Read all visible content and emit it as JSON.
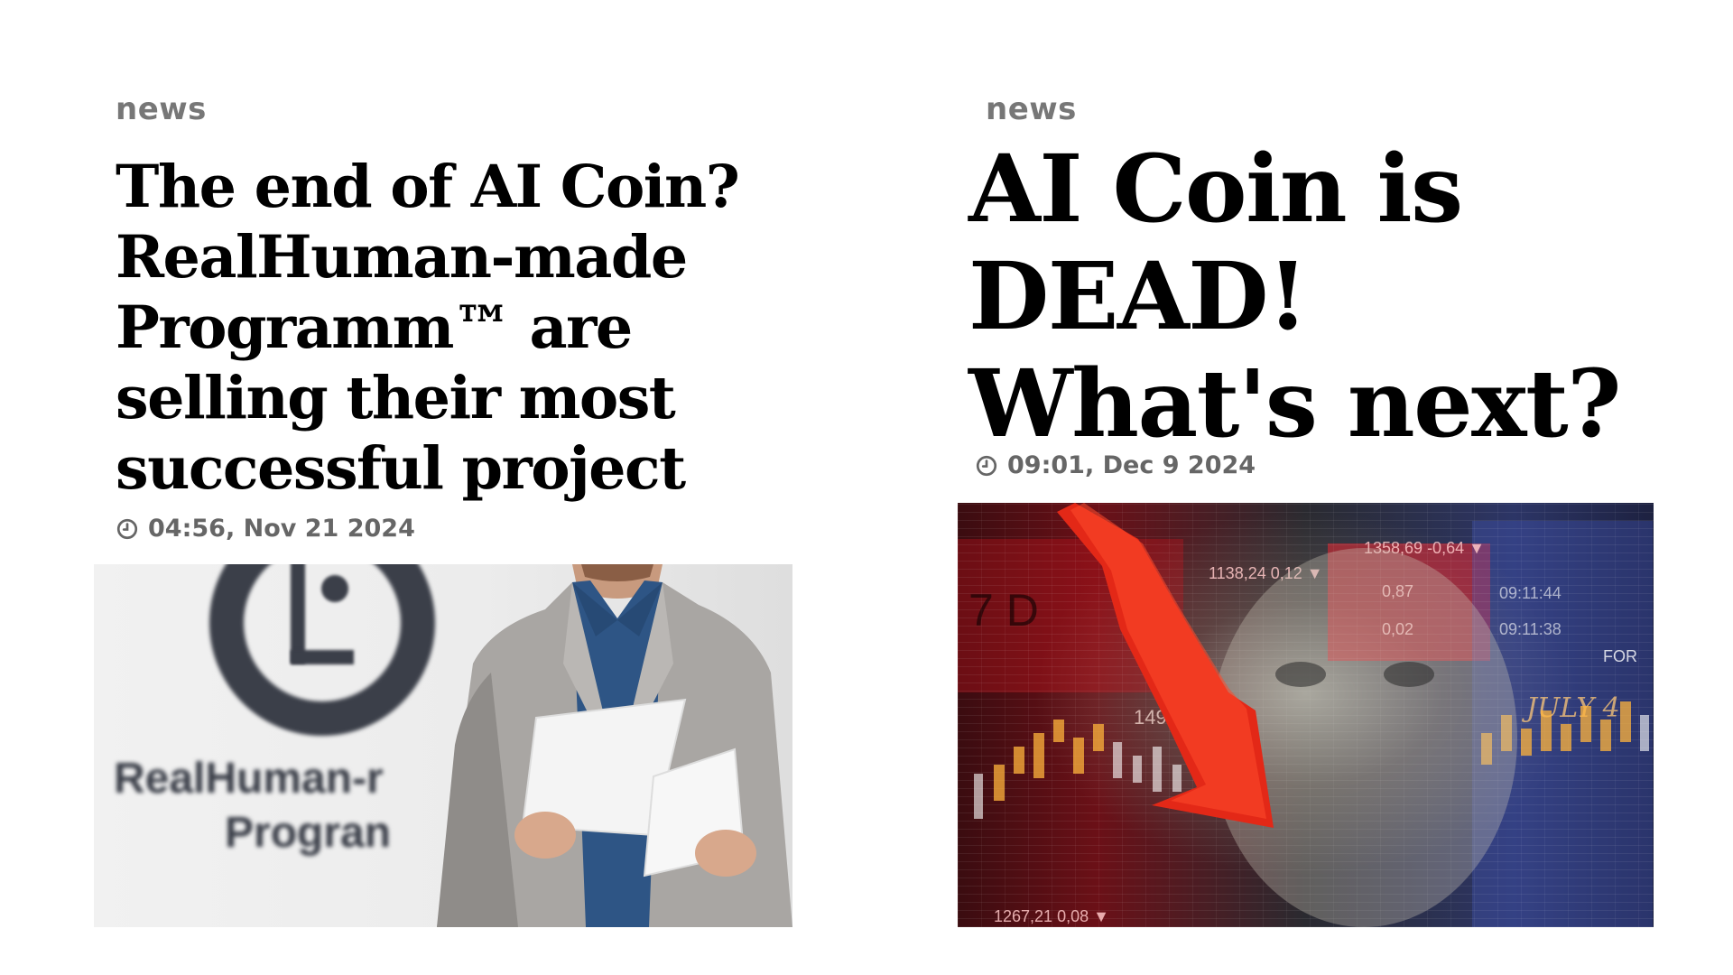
{
  "articles": [
    {
      "category": "news",
      "headline": "The end of AI Coin? RealHuman-made Programm™ are selling their most successful project",
      "timestamp": "04:56, Nov 21 2024",
      "thumbnail": {
        "brand_line_1": "RealHuman-r",
        "brand_line_2": "Progran"
      }
    },
    {
      "category": "news",
      "headline": "AI Coin is DEAD! What's next?",
      "timestamp": "09:01, Dec 9 2024",
      "thumbnail": {
        "tickers": [
          "1358,69 -0,64 ▼",
          "1138,24 0,12 ▼",
          "0,87",
          "0,02",
          "09:11:44",
          "09:11:38",
          "1498,6",
          "JULY 4",
          "FOR",
          "7 D",
          "1267,21 0,08 ▼"
        ]
      }
    }
  ],
  "colors": {
    "category": "#777777",
    "headline": "#000000",
    "timestamp": "#666666"
  },
  "icons": {
    "timestamp_icon": "clock-icon"
  }
}
